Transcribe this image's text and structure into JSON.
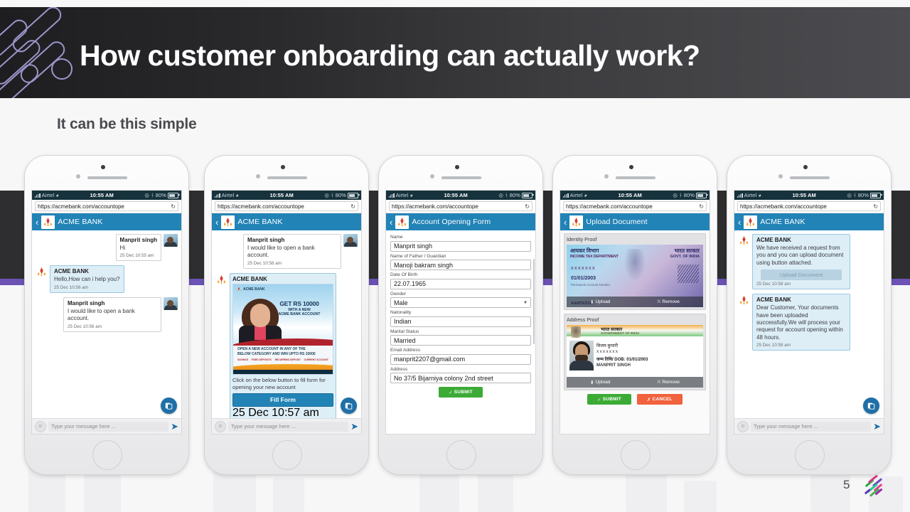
{
  "slide": {
    "title": "How customer onboarding can actually work?",
    "subtitle": "It can be this simple",
    "page_number": "5",
    "accent_purple": "#6b52b4",
    "accent_blue": "#2283b6",
    "band_dark": "#2e2e31"
  },
  "status_bar": {
    "carrier": "Airtel",
    "time": "10:55 AM",
    "battery": "80%"
  },
  "browser": {
    "url": "https://acmebank.com/accountope",
    "reload_icon": "reload-icon"
  },
  "composer": {
    "placeholder": "Type your message here ...",
    "emoji_icon": "emoji-icon",
    "send_icon": "send-icon"
  },
  "phones": [
    {
      "id": "phone-1-chat",
      "appbar": {
        "title": "ACME BANK",
        "back_icon": "back-chevron-icon",
        "logo_icon": "acme-diamond-logo-icon"
      },
      "messages": [
        {
          "side": "me",
          "sender": "Manprit singh",
          "text": "Hi",
          "time": "25 Dec 10:55 am"
        },
        {
          "side": "bank",
          "sender": "ACME BANK",
          "text": "Hello,How can i help you?",
          "time": "25 Dec 10:56 am"
        },
        {
          "side": "me",
          "sender": "Manprit singh",
          "text": "I would like to open a bank account.",
          "time": "25 Dec 10:56 am"
        }
      ],
      "fab_icon": "new-chat-icon"
    },
    {
      "id": "phone-2-offer",
      "appbar": {
        "title": "ACME BANK",
        "back_icon": "back-chevron-icon",
        "logo_icon": "acme-diamond-logo-icon"
      },
      "messages": [
        {
          "side": "me",
          "sender": "Manprit singh",
          "text": "I would like to open a bank account.",
          "time": "25 Dec 10:56 am"
        }
      ],
      "ad_card": {
        "sender": "ACME BANK",
        "banner": {
          "brand": "ACME BANK",
          "headline": "GET RS 10000",
          "sub1": "WITH A NEW",
          "sub2": "ACME BANK ACCOUNT",
          "strap1": "OPEN A NEW ACCOUNT IN ANY OF THE",
          "strap2": "BELOW CATEGORY AND WIN UPTO RS 10000",
          "categories": [
            "SAVINGS",
            "FIXED DEPOSITS",
            "RECURRING DEPOSIT",
            "CURRENT ACCOUNT"
          ]
        },
        "body_text": "Click on the below button to fill form for opening your new account",
        "button_label": "Fill Form",
        "time": "25 Dec 10:57 am"
      },
      "fab_icon": "new-chat-icon"
    },
    {
      "id": "phone-3-form",
      "appbar": {
        "title": "Account Opening Form",
        "back_icon": "back-chevron-icon",
        "logo_icon": "acme-diamond-logo-icon"
      },
      "fields": [
        {
          "label": "Name",
          "value": "Manprit singh",
          "type": "text"
        },
        {
          "label": "Name of Father / Guardian",
          "value": "Manoji bakram singh",
          "type": "text"
        },
        {
          "label": "Date Of Birth",
          "value": "22.07.1965",
          "type": "text"
        },
        {
          "label": "Gender",
          "value": "Male",
          "type": "select"
        },
        {
          "label": "Natonality",
          "value": "Indian",
          "type": "text"
        },
        {
          "label": "Marital Status",
          "value": "Married",
          "type": "text"
        },
        {
          "label": "Email Address",
          "value": "manprit2207@gmail.com",
          "type": "text"
        },
        {
          "label": "Address",
          "value": "No 37/5 Bijarniya colony 2nd street",
          "type": "text"
        }
      ],
      "submit_label": "SUBMIT"
    },
    {
      "id": "phone-4-upload",
      "appbar": {
        "title": "Upload Document",
        "back_icon": "back-chevron-icon",
        "logo_icon": "acme-diamond-logo-icon"
      },
      "sections": [
        {
          "heading": "Identity Proof",
          "doc": {
            "kind": "pan-card",
            "hindi_dept": "आयकर विभाग",
            "english_dept": "INCOME TAX DEPARTMENT",
            "hindi_gov": "भारत सरकार",
            "english_gov": "GOVT. OF INDIA",
            "masked_number": "xxxxxxx",
            "date": "01/01/2003",
            "caption": "Permanent Account Number",
            "signature": "AAMTE5347"
          },
          "upload_label": "Upload",
          "remove_label": "Remove"
        },
        {
          "heading": "Address Proof",
          "doc": {
            "kind": "aadhaar-card",
            "hindi_gov": "भारत सरकार",
            "english_gov": "GOVERNMENT OF INDIA",
            "hindi_name": "विजय कुमारी",
            "masked_number": "xxxxxxx",
            "dob_line": "जन्म तिथि/ DOB: 01/01/2003",
            "name": "MANPRIT SINGH"
          },
          "upload_label": "Upload",
          "remove_label": "Remove"
        }
      ],
      "submit_label": "SUBMIT",
      "cancel_label": "CANCEL"
    },
    {
      "id": "phone-5-confirmation",
      "appbar": {
        "title": "ACME BANK",
        "back_icon": "back-chevron-icon",
        "logo_icon": "acme-diamond-logo-icon"
      },
      "messages": [
        {
          "side": "bank",
          "sender": "ACME BANK",
          "text": "We have received a request from you and you can upload document using button attached.",
          "button_label": "Upload Document",
          "time": "25 Dec 10:58 am"
        },
        {
          "side": "bank",
          "sender": "ACME BANK",
          "text": "Dear Customer, Your documents have been uploaded successfully.We will process your request for account opening within 48 hours.",
          "time": "25 Dec 10:58 am"
        }
      ],
      "fab_icon": "new-chat-icon"
    }
  ]
}
